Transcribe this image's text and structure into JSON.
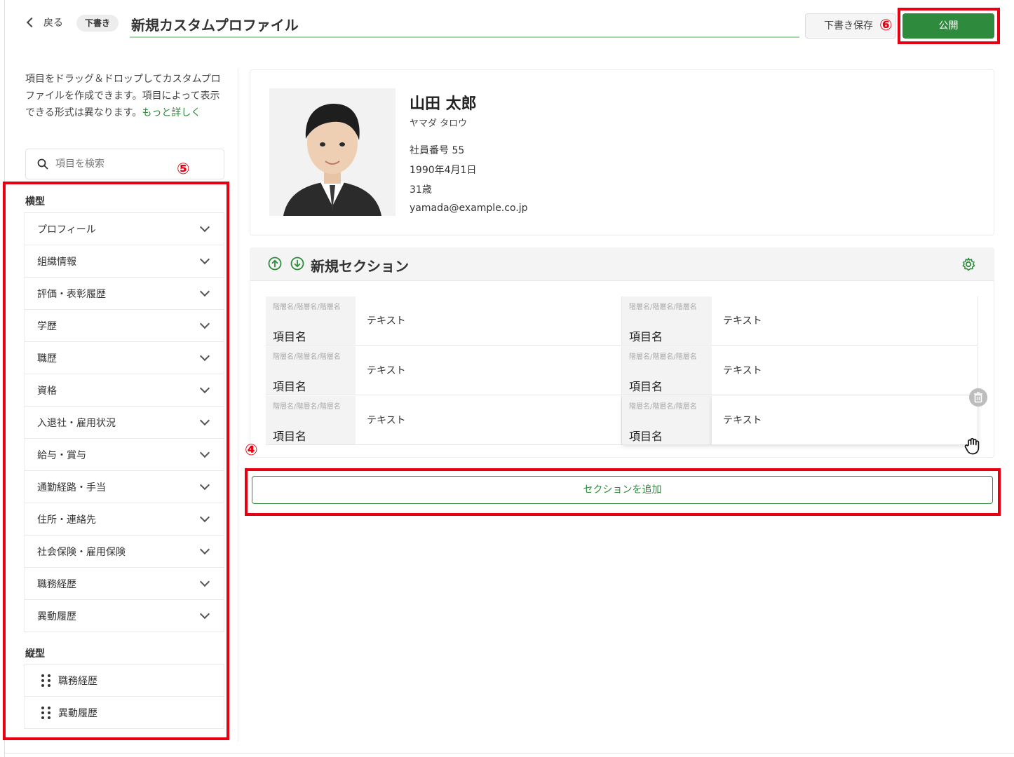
{
  "header": {
    "back_label": "戻る",
    "draft_badge": "下書き",
    "title_value": "新規カスタムプロファイル",
    "save_draft_label": "下書き保存",
    "publish_label": "公開"
  },
  "markers": {
    "publish": "⑥",
    "field_list": "⑤",
    "add_section": "④"
  },
  "sidebar": {
    "intro_text": "項目をドラッグ＆ドロップしてカスタムプロファイルを作成できます。項目によって表示できる形式は異なります。",
    "intro_link": "もっと詳しく",
    "search_placeholder": "項目を検索",
    "horizontal_label": "横型",
    "horizontal_items": [
      {
        "label": "プロフィール"
      },
      {
        "label": "組織情報"
      },
      {
        "label": "評価・表彰履歴"
      },
      {
        "label": "学歴"
      },
      {
        "label": "職歴"
      },
      {
        "label": "資格"
      },
      {
        "label": "入退社・雇用状況"
      },
      {
        "label": "給与・賞与"
      },
      {
        "label": "通勤経路・手当"
      },
      {
        "label": "住所・連絡先"
      },
      {
        "label": "社会保険・雇用保険"
      },
      {
        "label": "職務経歴"
      },
      {
        "label": "異動履歴"
      }
    ],
    "vertical_label": "縦型",
    "vertical_items": [
      {
        "label": "職務経歴"
      },
      {
        "label": "異動履歴"
      }
    ]
  },
  "profile": {
    "name": "山田 太郎",
    "kana": "ヤマダ タロウ",
    "employee_no": "社員番号 55",
    "birthday": "1990年4月1日",
    "age": "31歳",
    "email": "yamada@example.co.jp"
  },
  "section": {
    "title": "新規セクション",
    "cells": [
      {
        "path": "階層名/階層名/階層名",
        "name": "項目名",
        "value": "テキスト"
      },
      {
        "path": "階層名/階層名/階層名",
        "name": "項目名",
        "value": "テキスト"
      },
      {
        "path": "階層名/階層名/階層名",
        "name": "項目名",
        "value": "テキスト"
      },
      {
        "path": "階層名/階層名/階層名",
        "name": "項目名",
        "value": "テキスト"
      },
      {
        "path": "階層名/階層名/階層名",
        "name": "項目名",
        "value": "テキスト"
      },
      {
        "path": "階層名/階層名/階層名",
        "name": "項目名",
        "value": "テキスト"
      }
    ],
    "add_section_label": "セクションを追加"
  },
  "colors": {
    "accent_green": "#2e8b3d",
    "highlight_red": "#e60012"
  }
}
